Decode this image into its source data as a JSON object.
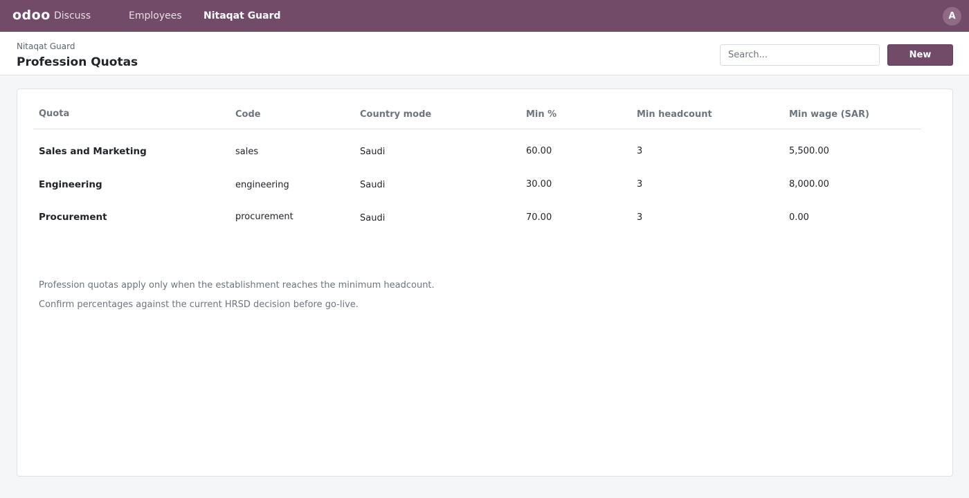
{
  "navbar": {
    "brand": "odoo",
    "items": [
      {
        "label": "Discuss",
        "active": false
      },
      {
        "label": "Employees",
        "active": false
      },
      {
        "label": "Nitaqat Guard",
        "active": true
      }
    ],
    "avatar_initial": "A",
    "color": "#714b67"
  },
  "control_panel": {
    "breadcrumb": "Nitaqat Guard",
    "title": "Profession Quotas",
    "search_placeholder": "Search...",
    "new_label": "New"
  },
  "table": {
    "columns": [
      "Quota",
      "Code",
      "Country mode",
      "Min %",
      "Min headcount",
      "Min wage (SAR)"
    ],
    "rows": [
      {
        "quota": "Sales and Marketing",
        "code": "sales",
        "country_mode": "Saudi",
        "min_pct": "60.00",
        "min_headcount": "3",
        "min_wage": "5,500.00"
      },
      {
        "quota": "Engineering",
        "code": "engineering",
        "country_mode": "Saudi",
        "min_pct": "30.00",
        "min_headcount": "3",
        "min_wage": "8,000.00"
      },
      {
        "quota": "Procurement",
        "code": "procurement",
        "country_mode": "Saudi",
        "min_pct": "70.00",
        "min_headcount": "3",
        "min_wage": "0.00"
      }
    ]
  },
  "notes": [
    "Profession quotas apply only when the establishment reaches the minimum headcount.",
    "Confirm percentages against the current HRSD decision before go-live."
  ]
}
